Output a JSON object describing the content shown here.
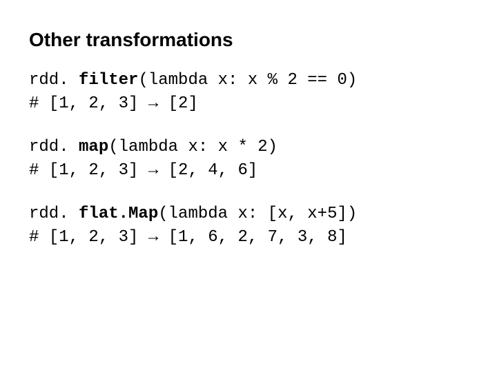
{
  "heading": "Other transformations",
  "blocks": [
    {
      "obj": "rdd. ",
      "method": "filter",
      "args": "(lambda x: x % 2 == 0)",
      "comment": "# [1, 2, 3] → [2]"
    },
    {
      "obj": "rdd. ",
      "method": "map",
      "args": "(lambda x: x * 2)",
      "comment": "# [1, 2, 3] → [2, 4, 6]"
    },
    {
      "obj": "rdd. ",
      "method": "flat.Map",
      "args": "(lambda x: [x, x+5])",
      "comment": "# [1, 2, 3] → [1, 6, 2, 7, 3, 8]"
    }
  ]
}
